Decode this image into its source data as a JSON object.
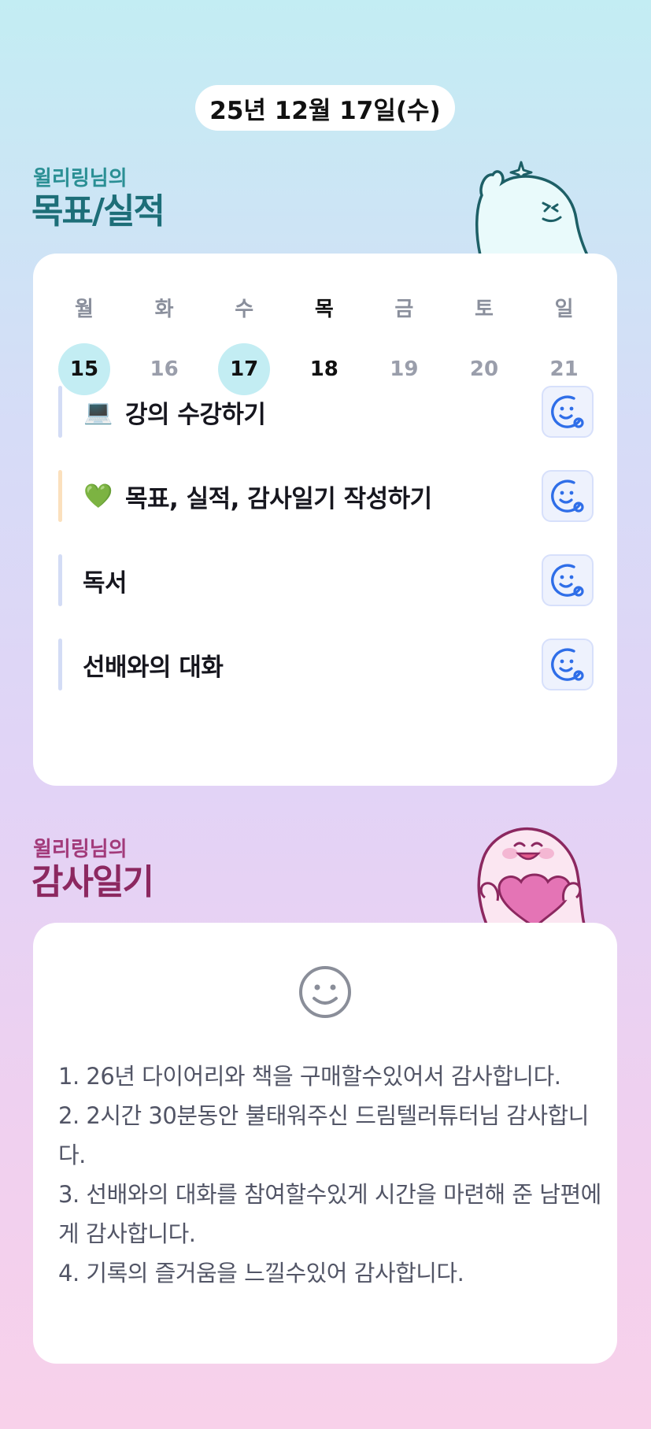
{
  "header": {
    "date": "25년 12월 17일(수)"
  },
  "goals": {
    "subtitle": "윌리링님의",
    "title": "목표/실적",
    "week": [
      {
        "day": "월",
        "num": "15",
        "status": "done"
      },
      {
        "day": "화",
        "num": "16",
        "status": "none"
      },
      {
        "day": "수",
        "num": "17",
        "status": "done"
      },
      {
        "day": "목",
        "num": "18",
        "status": "today"
      },
      {
        "day": "금",
        "num": "19",
        "status": "none"
      },
      {
        "day": "토",
        "num": "20",
        "status": "none"
      },
      {
        "day": "일",
        "num": "21",
        "status": "none"
      }
    ],
    "tasks": [
      {
        "emoji": "💻",
        "label": "강의 수강하기",
        "bar_color": "#d3dcf5"
      },
      {
        "emoji": "💚",
        "label": "목표, 실적, 감사일기 작성하기",
        "bar_color": "#fbe0bd"
      },
      {
        "emoji": "",
        "label": "독서",
        "bar_color": "#d3dcf5"
      },
      {
        "emoji": "",
        "label": "선배와의 대화",
        "bar_color": "#d3dcf5"
      }
    ],
    "action_icon": "smiley-add-icon"
  },
  "gratitude": {
    "subtitle": "윌리링님의",
    "title": "감사일기",
    "mood_icon": "neutral-smiley-icon",
    "lines": [
      "1. 26년 다이어리와 책을 구매할수있어서 감사합니다.",
      "2. 2시간 30분동안 불태워주신 드림텔러튜터님 감사합니다.",
      "3. 선배와의 대화를 참여할수있게 시간을 마련해 준 남편에게 감사합니다.",
      "4. 기록의 즐거움을 느낄수있어 감사합니다."
    ]
  },
  "colors": {
    "accent_blue": "#2f6ee8",
    "done_day_bg": "#c3edf3",
    "goal_title": "#1d6e78",
    "gratitude_title": "#8c2860"
  }
}
